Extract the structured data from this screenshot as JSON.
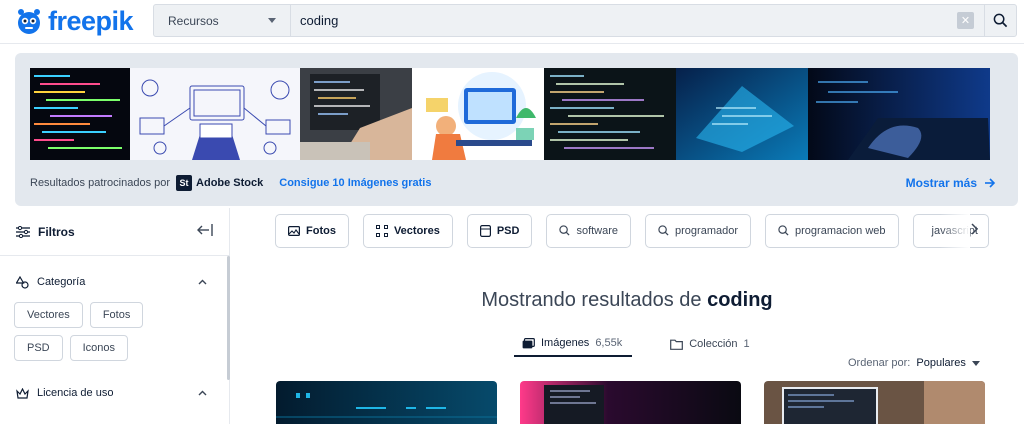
{
  "header": {
    "logo_text": "freepik",
    "search_category": "Recursos",
    "search_value": "coding",
    "clear_label": "✕"
  },
  "sponsored": {
    "label": "Resultados patrocinados por",
    "adobe_badge": "St",
    "adobe_text": "Adobe Stock",
    "promo": "Consigue 10 Imágenes gratis",
    "more": "Mostrar más"
  },
  "sidebar": {
    "title": "Filtros",
    "category": {
      "title": "Categoría",
      "chips": [
        "Vectores",
        "Fotos",
        "PSD",
        "Iconos"
      ]
    },
    "license": {
      "title": "Licencia de uso"
    }
  },
  "tags": {
    "fotos": "Fotos",
    "vectores": "Vectores",
    "psd": "PSD",
    "software": "software",
    "programador": "programador",
    "programacion_web": "programacion web",
    "javascript": "javascript"
  },
  "results": {
    "prefix": "Mostrando resultados de",
    "query": "coding"
  },
  "tabs": {
    "images_label": "Imágenes",
    "images_count": "6,55k",
    "collection_label": "Colección",
    "collection_count": "1"
  },
  "sort": {
    "label": "Ordenar por:",
    "value": "Populares"
  },
  "colors": {
    "brand": "#1273eb",
    "text": "#0e1c33",
    "banner_bg": "#e3e8ee"
  }
}
